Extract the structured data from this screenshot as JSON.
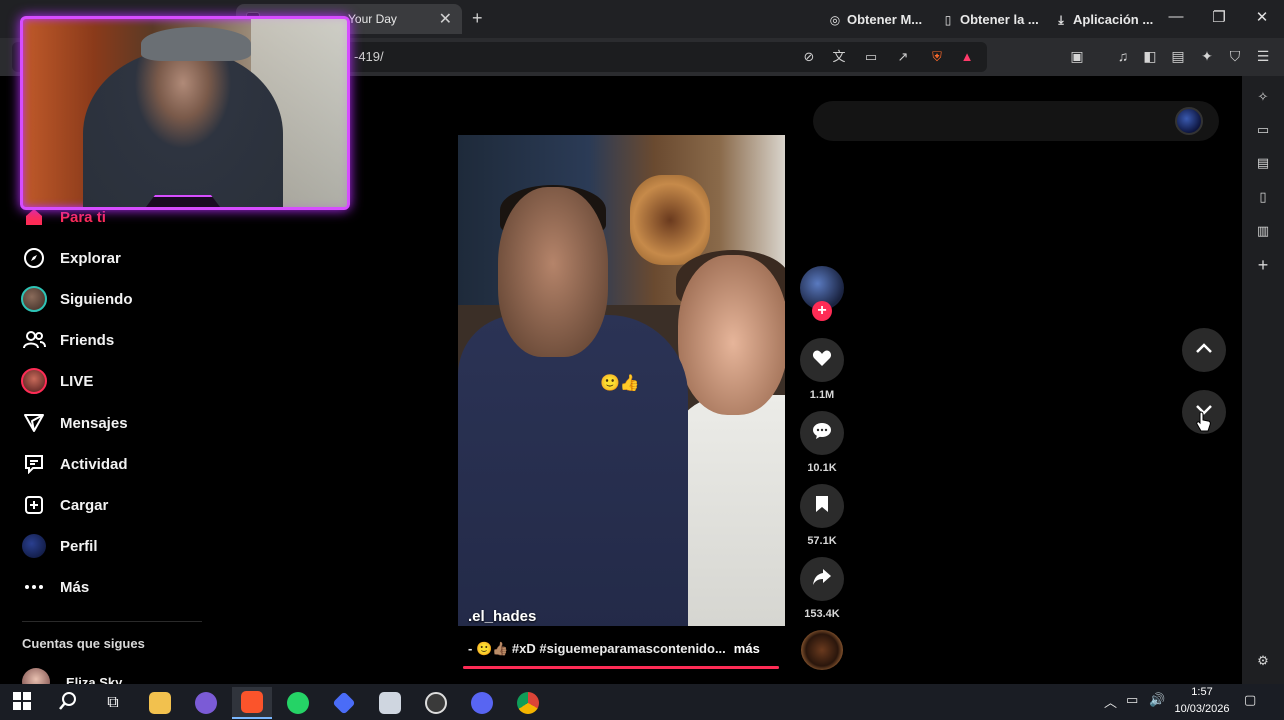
{
  "browser": {
    "active_tab_title": "Your Day",
    "new_tab_symbol": "+",
    "close_symbol": "✕",
    "url_fragment": "-419/",
    "window_controls": {
      "minimize": "—",
      "maximize": "❐",
      "close": "✕"
    }
  },
  "nav": {
    "items": [
      {
        "label": "Para ti",
        "icon": "home-icon"
      },
      {
        "label": "Explorar",
        "icon": "compass-icon"
      },
      {
        "label": "Siguiendo",
        "icon": "avatar"
      },
      {
        "label": "Friends",
        "icon": "friends-icon"
      },
      {
        "label": "LIVE",
        "icon": "live-avatar"
      },
      {
        "label": "Mensajes",
        "icon": "send-icon"
      },
      {
        "label": "Actividad",
        "icon": "activity-icon"
      },
      {
        "label": "Cargar",
        "icon": "upload-icon"
      },
      {
        "label": "Perfil",
        "icon": "profile-avatar"
      },
      {
        "label": "Más",
        "icon": "more-icon"
      }
    ],
    "following_header": "Cuentas que sigues",
    "following_accounts": [
      {
        "name": "Eliza Sky"
      }
    ]
  },
  "get_bar": {
    "items": [
      {
        "label": "Obtener M...",
        "icon": "coin-icon"
      },
      {
        "label": "Obtener la ...",
        "icon": "phone-icon"
      },
      {
        "label": "Aplicación ...",
        "icon": "download-icon"
      }
    ]
  },
  "video": {
    "username": ".el_hades",
    "caption": "- 🙂👍🏽 #xD #siguemeparamascontenido...",
    "caption_more": "más",
    "progress": 1.0
  },
  "actions": {
    "likes": "1.1M",
    "comments": "10.1K",
    "saves": "57.1K",
    "shares": "153.4K"
  },
  "taskbar": {
    "time": "1:57",
    "date": "10/03/2026"
  },
  "colors": {
    "accent": "#fe2c55",
    "webcam_border": "#d64dff",
    "following_ring": "#2ec4b6"
  }
}
